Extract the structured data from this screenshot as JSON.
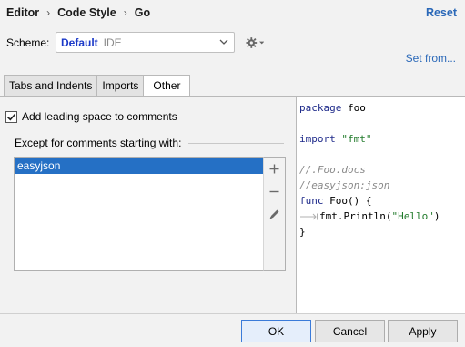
{
  "breadcrumb": {
    "items": [
      "Editor",
      "Code Style",
      "Go"
    ],
    "separator": "›"
  },
  "reset_label": "Reset",
  "scheme": {
    "label": "Scheme:",
    "name": "Default",
    "sub": "IDE"
  },
  "set_from_label": "Set from...",
  "tabs": [
    {
      "label": "Tabs and Indents",
      "active": false
    },
    {
      "label": "Imports",
      "active": false
    },
    {
      "label": "Other",
      "active": true
    }
  ],
  "options": {
    "leading_space": {
      "label": "Add leading space to comments",
      "checked": true
    },
    "except_label": "Except for comments starting with:",
    "exceptions": [
      "easyjson"
    ]
  },
  "code": {
    "package_kw": "package",
    "package_name": " foo",
    "import_kw": "import",
    "import_path": "\"fmt\"",
    "comment1": "//.Foo.docs",
    "comment2": "//easyjson:json",
    "func_kw": "func",
    "func_sig": " Foo() {",
    "call": "fmt.Println(",
    "call_arg": "\"Hello\"",
    "call_end": ")",
    "close_brace": "}"
  },
  "buttons": {
    "ok": "OK",
    "cancel": "Cancel",
    "apply": "Apply"
  },
  "colors": {
    "link": "#2a68b8",
    "selection": "#2570c5",
    "scheme": "#1a38c8"
  }
}
